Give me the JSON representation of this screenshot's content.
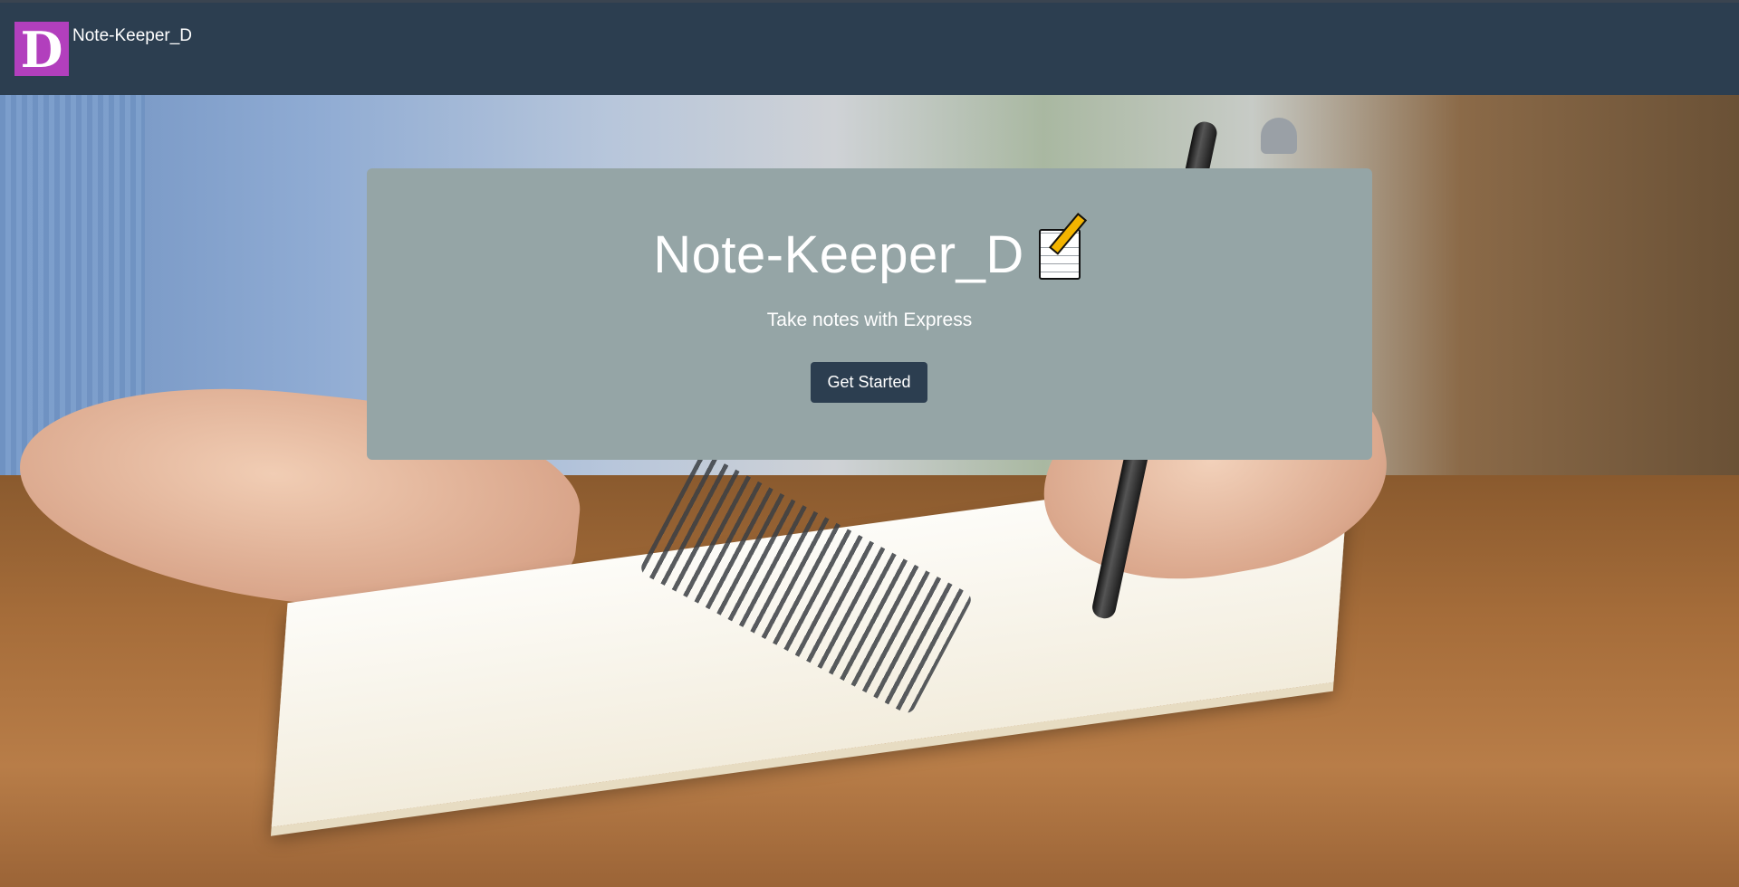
{
  "navbar": {
    "logo_letter": "D",
    "brand_text": "Note-Keeper_D"
  },
  "hero": {
    "background_icon": "hero-photo-hands-writing-notebook"
  },
  "jumbotron": {
    "title": "Note-Keeper_D",
    "title_icon": "memo-icon",
    "subtitle": "Take notes with Express",
    "cta_label": "Get Started"
  },
  "colors": {
    "navbar": "#2c3e50",
    "logo_bg": "#b23fbd",
    "jumbotron_bg": "#95a5a6",
    "button_bg": "#2c3e50",
    "text": "#ffffff"
  }
}
